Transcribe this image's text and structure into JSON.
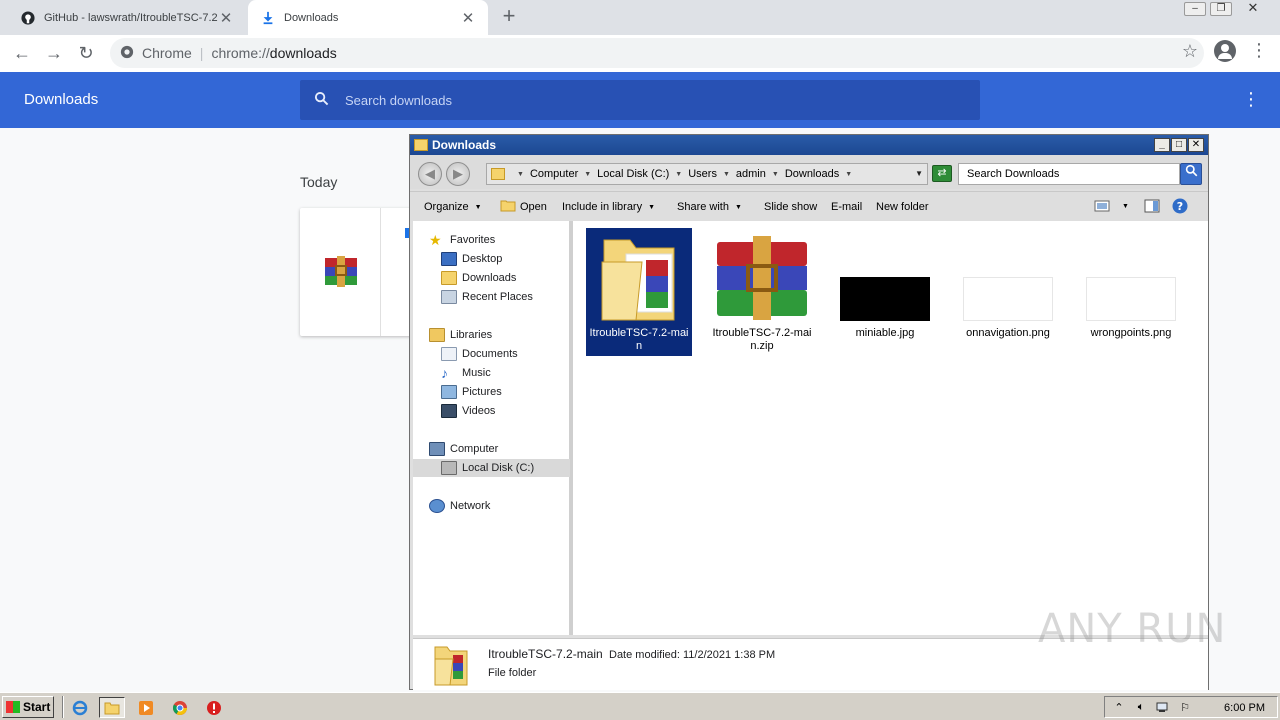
{
  "browser": {
    "tabs": [
      {
        "title": "GitHub - lawswrath/ItroubleTSC-7.2",
        "icon": "github-icon",
        "active": false
      },
      {
        "title": "Downloads",
        "icon": "download-icon",
        "active": true
      }
    ],
    "omnibox": {
      "security_label": "Chrome",
      "url_scheme": "chrome://",
      "url_host": "downloads"
    }
  },
  "downloads_page": {
    "title": "Downloads",
    "search_placeholder": "Search downloads",
    "section_label": "Today",
    "accent_color": "#3367d6"
  },
  "explorer": {
    "title": "Downloads",
    "breadcrumb": [
      "Computer",
      "Local Disk (C:)",
      "Users",
      "admin",
      "Downloads"
    ],
    "search_placeholder": "Search Downloads",
    "commands": {
      "organize": "Organize",
      "open": "Open",
      "include_in_library": "Include in library",
      "share_with": "Share with",
      "slide_show": "Slide show",
      "email": "E-mail",
      "new_folder": "New folder"
    },
    "nav": {
      "favorites": "Favorites",
      "desktop": "Desktop",
      "downloads": "Downloads",
      "recent_places": "Recent Places",
      "libraries": "Libraries",
      "documents": "Documents",
      "music": "Music",
      "pictures": "Pictures",
      "videos": "Videos",
      "computer": "Computer",
      "local_disk": "Local Disk (C:)",
      "network": "Network"
    },
    "files": [
      {
        "name": "ItroubleTSC-7.2-main",
        "kind": "folder",
        "selected": true
      },
      {
        "name": "ItroubleTSC-7.2-main.zip",
        "kind": "winrar-archive",
        "selected": false
      },
      {
        "name": "miniable.jpg",
        "kind": "image-dark",
        "selected": false
      },
      {
        "name": "onnavigation.png",
        "kind": "image-light",
        "selected": false
      },
      {
        "name": "wrongpoints.png",
        "kind": "image-light",
        "selected": false
      }
    ],
    "details": {
      "name": "ItroubleTSC-7.2-main",
      "date_label": "Date modified:",
      "date_value": "11/2/2021 1:38 PM",
      "type": "File folder"
    },
    "selection_color": "#0a2a7a"
  },
  "watermark": "ANY RUN",
  "taskbar": {
    "start_label": "Start",
    "clock": "6:00 PM",
    "pinned": [
      "internet-explorer-icon",
      "explorer-folder-icon",
      "media-player-icon",
      "chrome-icon",
      "stop-sign-icon"
    ]
  }
}
